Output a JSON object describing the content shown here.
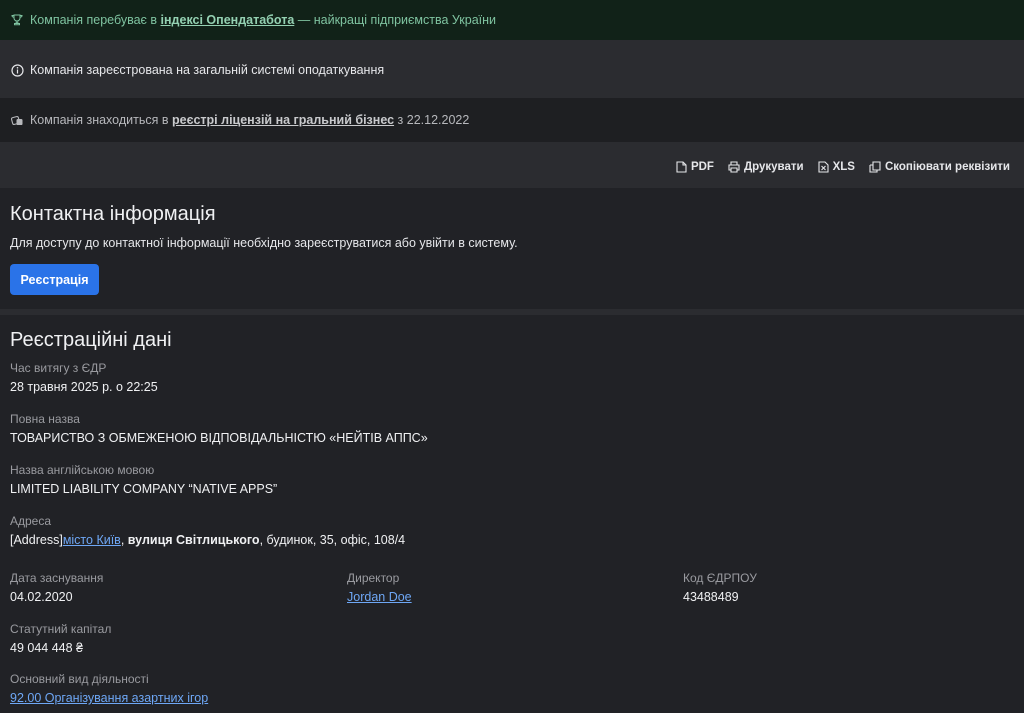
{
  "banners": {
    "index": {
      "prefix": "Компанія перебуває в ",
      "link": "індексі Опендатабота",
      "suffix": " — найкращі підприємства України"
    },
    "tax": {
      "text": "Компанія зареєстрована на загальній системі оподаткування"
    },
    "license": {
      "prefix": "Компанія знаходиться в ",
      "link": "реєстрі ліцензій на гральний бізнес",
      "suffix": " з 22.12.2022"
    }
  },
  "toolbar": {
    "pdf": "PDF",
    "print": "Друкувати",
    "xls": "XLS",
    "copy": "Скопіювати реквізити"
  },
  "contact": {
    "title": "Контактна інформація",
    "description": "Для доступу до контактної інформації необхідно зареєструватися або увійти в систему.",
    "register_button": "Реєстрація"
  },
  "registration": {
    "title": "Реєстраційні дані",
    "extract_time": {
      "label": "Час витягу з ЄДР",
      "value": "28 травня 2025 р. о 22:25"
    },
    "full_name": {
      "label": "Повна назва",
      "value": "ТОВАРИСТВО З ОБМЕЖЕНОЮ ВІДПОВІДАЛЬНІСТЮ «НЕЙТІВ АППС»"
    },
    "english_name": {
      "label": "Назва англійською мовою",
      "value": "LIMITED LIABILITY COMPANY “NATIVE APPS”"
    },
    "address": {
      "label": "Адреса",
      "prefix": "[Address]",
      "city": "місто Київ",
      "sep": ", ",
      "street": "вулиця Світлицького",
      "suffix": ", будинок, 35, офіс, 108/4"
    },
    "founded": {
      "label": "Дата заснування",
      "value": "04.02.2020"
    },
    "director": {
      "label": "Директор",
      "value": "Jordan Doe"
    },
    "edrpou": {
      "label": "Код ЄДРПОУ",
      "value": "43488489"
    },
    "capital": {
      "label": "Статутний капітал",
      "value": "49 044 448 ₴"
    },
    "activity": {
      "label": "Основний вид діяльності",
      "value": "92.00 Організування азартних ігор"
    }
  },
  "colors": {
    "accent": "#2a73e8",
    "link": "#6ea7f5",
    "index_banner_bg": "#112218"
  }
}
